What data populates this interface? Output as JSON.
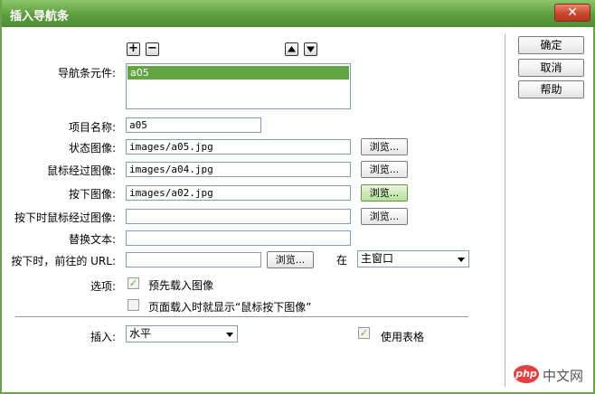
{
  "window": {
    "title": "插入导航条",
    "close_glyph": "✕"
  },
  "side_buttons": {
    "ok": "确定",
    "cancel": "取消",
    "help": "帮助"
  },
  "elements": {
    "label": "导航条元件:",
    "add_glyph": "+",
    "remove_glyph": "−",
    "items": [
      "a05"
    ]
  },
  "form": {
    "item_name_label": "项目名称:",
    "item_name_value": "a05",
    "up_image_label": "状态图像:",
    "up_image_value": "images/a05.jpg",
    "over_image_label": "鼠标经过图像:",
    "over_image_value": "images/a04.jpg",
    "down_image_label": "按下图像:",
    "down_image_value": "images/a02.jpg",
    "over_while_down_label": "按下时鼠标经过图像:",
    "over_while_down_value": "",
    "alt_text_label": "替换文本:",
    "alt_text_value": "",
    "when_clicked_label": "按下时，前往的 URL:",
    "when_clicked_value": "",
    "in_label": "在",
    "target_value": "主窗口",
    "browse_label": "浏览..."
  },
  "options": {
    "label": "选项:",
    "preload_label": "预先载入图像",
    "preload_checked": true,
    "show_down_label": "页面载入时就显示“鼠标按下图像”",
    "show_down_checked": false
  },
  "insert": {
    "label": "插入:",
    "value": "水平",
    "use_tables_label": "使用表格",
    "use_tables_checked": true
  },
  "watermark": {
    "badge": "php",
    "text": "中文网"
  }
}
